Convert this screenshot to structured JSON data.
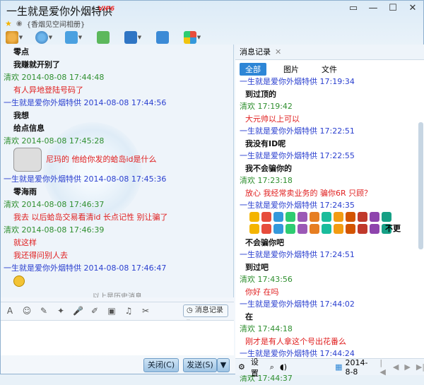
{
  "window": {
    "title": "一生就是爱你外烟特供",
    "vip_badge": "VIP6",
    "subtitle_link": "{香烟见空间相册}",
    "controls": [
      "▭",
      "—",
      "☐",
      "✕"
    ]
  },
  "toolbar": {
    "items": [
      "voice-icon",
      "video-icon",
      "folder-icon",
      "add-chat-icon",
      "screen-share-icon",
      "remote-desktop-icon",
      "apps-icon"
    ]
  },
  "chat": {
    "messages": [
      {
        "kind": "text-black",
        "text": "零点"
      },
      {
        "kind": "text-black",
        "text": "我赚就开别了"
      },
      {
        "kind": "header-other",
        "text": "清欢 2014-08-08 17:44:48"
      },
      {
        "kind": "text-red",
        "text": "有人异地登陆号码了"
      },
      {
        "kind": "header-self",
        "text": "一生就是爱你外烟特供 2014-08-08 17:44:56"
      },
      {
        "kind": "text-black",
        "text": "我想"
      },
      {
        "kind": "text-black",
        "text": "给点信息"
      },
      {
        "kind": "header-other",
        "text": "清欢 2014-08-08 17:45:28"
      },
      {
        "kind": "face-red",
        "text": "尼玛的 他给你发的蛤岛id是什么"
      },
      {
        "kind": "header-self",
        "text": "一生就是爱你外烟特供 2014-08-08 17:45:36"
      },
      {
        "kind": "text-black",
        "text": "零海雨"
      },
      {
        "kind": "header-other",
        "text": "清欢 2014-08-08 17:46:37"
      },
      {
        "kind": "text-red",
        "text": "我去 以后蛤岛交易看清id 长点记性 别让骗了"
      },
      {
        "kind": "header-other",
        "text": "清欢 2014-08-08 17:46:39"
      },
      {
        "kind": "text-red",
        "text": "就这样"
      },
      {
        "kind": "text-red",
        "text": "我还得问别人去"
      },
      {
        "kind": "header-self",
        "text": "一生就是爱你外烟特供 2014-08-08 17:46:47"
      },
      {
        "kind": "emoji",
        "text": ""
      }
    ],
    "history_label": "以上是历史消息"
  },
  "edit_toolbar": {
    "icons": [
      "font-icon",
      "emoji-icon",
      "magic-icon",
      "shake-icon",
      "mic-icon",
      "edit-icon",
      "image-icon",
      "music-icon",
      "scissors-icon"
    ],
    "glyphs": [
      "A",
      "☺",
      "✎",
      "✦",
      "🎤",
      "✐",
      "▣",
      "♫",
      "✂"
    ],
    "msg_record_label": "消息记录"
  },
  "buttons": {
    "close": "关闭(C)",
    "send": "发送(S)"
  },
  "history_panel": {
    "tab_label": "消息记录",
    "filters": [
      "全部",
      "图片",
      "文件"
    ],
    "messages": [
      {
        "kind": "header-self",
        "text": "一生就是爱你外烟特供 17:19:34"
      },
      {
        "kind": "text-black",
        "text": "到过顶的"
      },
      {
        "kind": "header-other",
        "text": "清欢 17:19:42"
      },
      {
        "kind": "text-red",
        "text": "大元帅以上可以"
      },
      {
        "kind": "header-self",
        "text": "一生就是爱你外烟特供 17:22:51"
      },
      {
        "kind": "text-black",
        "text": "我没有ID呢"
      },
      {
        "kind": "header-self",
        "text": "一生就是爱你外烟特供 17:22:55"
      },
      {
        "kind": "text-black",
        "text": "我不会骗你的"
      },
      {
        "kind": "header-other",
        "text": "清欢 17:23:18"
      },
      {
        "kind": "text-red",
        "text": "放心 我经常卖业务的 骗你6R 只顾？"
      },
      {
        "kind": "header-self",
        "text": "一生就是爱你外烟特供 17:24:35"
      },
      {
        "kind": "emojis",
        "text": ""
      },
      {
        "kind": "emojis",
        "text": ""
      },
      {
        "kind": "text-black",
        "text": "不会骗你吧"
      },
      {
        "kind": "header-self",
        "text": "一生就是爱你外烟特供 17:24:51"
      },
      {
        "kind": "text-black",
        "text": "到过吧"
      },
      {
        "kind": "header-other",
        "text": "清欢 17:43:56"
      },
      {
        "kind": "text-red",
        "text": "你好 在吗"
      },
      {
        "kind": "header-self",
        "text": "一生就是爱你外烟特供 17:44:02"
      },
      {
        "kind": "text-black",
        "text": "在"
      },
      {
        "kind": "header-other",
        "text": "清欢 17:44:18"
      },
      {
        "kind": "text-red",
        "text": "刚才是有人拿这个号出花番么"
      },
      {
        "kind": "header-self",
        "text": "一生就是爱你外烟特供 17:44:24"
      },
      {
        "kind": "text-black",
        "text": "是啊"
      },
      {
        "kind": "header-other",
        "text": "清欢 17:44:37"
      }
    ],
    "side_text": "不更",
    "settings_label": "设置",
    "date": "2014-8-8"
  },
  "colors": {
    "self": "#2a3fcf",
    "other": "#2f8f2f",
    "red_text": "#e02020",
    "accent": "#2e86d6"
  }
}
